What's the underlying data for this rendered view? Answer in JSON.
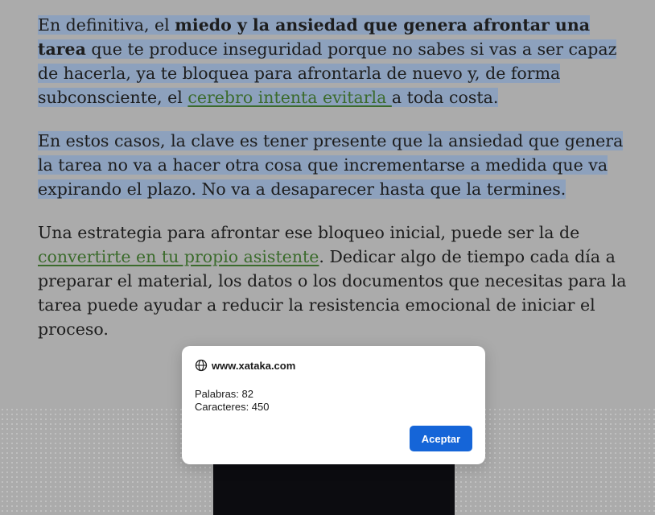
{
  "article": {
    "p1": {
      "pre": "En definitiva, el ",
      "bold": "miedo y la ansiedad que genera afrontar una tarea",
      "mid": " que te produce inseguridad porque no sabes si vas a ser capaz de hacerla, ya te bloquea para afrontarla de nuevo y, de forma subconsciente, el ",
      "link": "cerebro intenta evitarla ",
      "post": "a toda costa."
    },
    "p2": "En estos casos, la clave es tener presente que la ansiedad que genera la tarea no va a hacer otra cosa que incrementarse a medida que va expirando el plazo. No va a desaparecer hasta que la termines.",
    "p3": {
      "pre": "Una estrategia para afrontar ese bloqueo inicial, puede ser la de ",
      "link": "convertirte en tu propio asistente",
      "post": ". Dedicar algo de tiempo cada día a preparar el material, los datos o los documentos que necesitas para la tarea puede ayudar a reducir la resistencia emocional de iniciar el proceso."
    }
  },
  "dialog": {
    "icon": "globe-icon",
    "domain": "www.xataka.com",
    "words": "Palabras: 82",
    "chars": "Caracteres: 450",
    "accept_label": "Aceptar"
  },
  "colors": {
    "selection": "#8da1bd",
    "link": "#3b6b2c",
    "overlay_bg": "#ababab",
    "button": "#1565d8"
  }
}
